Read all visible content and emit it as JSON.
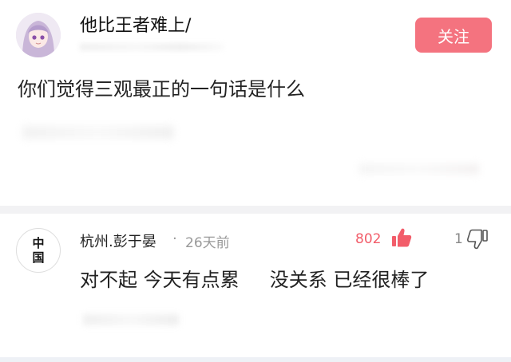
{
  "post": {
    "author": "他比王者难上/",
    "follow_label": "关注",
    "question": "你们觉得三观最正的一句话是什么"
  },
  "comment": {
    "avatar_chars": [
      "中",
      "国"
    ],
    "user": "杭州.彭于晏",
    "dot": "·",
    "time": "26天前",
    "likes": "802",
    "dislikes": "1",
    "text": "对不起 今天有点累     没关系 已经很棒了"
  },
  "icons": {
    "thumb_up": "thumb-up-icon",
    "thumb_down": "thumb-down-icon"
  },
  "colors": {
    "follow_bg": "#f4737f",
    "like_red": "#f25d6a"
  }
}
